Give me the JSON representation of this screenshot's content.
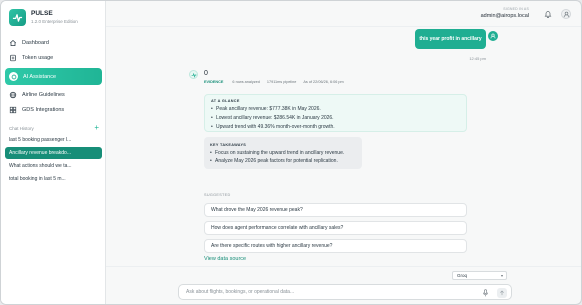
{
  "brand": {
    "name": "PULSE",
    "edition": "1.2.0 Enterprise Edition"
  },
  "nav": [
    {
      "label": "Dashboard",
      "icon": "home-icon"
    },
    {
      "label": "Token usage",
      "icon": "token-icon"
    },
    {
      "label": "AI Assistance",
      "icon": "assistant-icon",
      "active": true
    },
    {
      "label": "Airline Guidelines",
      "icon": "globe-icon"
    },
    {
      "label": "GDS Integrations",
      "icon": "grid-icon"
    }
  ],
  "history": {
    "label": "Chat History",
    "add_icon": "plus-icon",
    "items": [
      "last 5 booking passenger l...",
      "Ancillary revenue breakdo...",
      "What actions should we ta...",
      "total booking in last 5 m..."
    ],
    "active_index": 1
  },
  "topbar": {
    "signed_label": "SIGNED IN AS",
    "user": "admin@airops.local"
  },
  "chat": {
    "user_message": "this year profit in ancillary",
    "user_time": "12:45 pm",
    "bot_answer": "0",
    "meta": {
      "evidence": "EVIDENCE",
      "rows": "6 rows analyzed",
      "pipeline": "17911ms pipeline",
      "as_of": "As of 22/06/26, 6:06 pm"
    },
    "glance": {
      "title": "AT A GLANCE",
      "bullets": [
        "Peak ancillary revenue: $777.38K in May 2026.",
        "Lowest ancillary revenue: $286.54K in January 2026.",
        "Upward trend with 49.36% month-over-month growth."
      ]
    },
    "takeaways": {
      "title": "KEY TAKEAWAYS",
      "bullets": [
        "Focus on sustaining the upward trend in ancillary revenue.",
        "Analyze May 2026 peak factors for potential replication."
      ]
    },
    "suggested_label": "SUGGESTED",
    "suggestions": [
      "What drove the May 2026 revenue peak?",
      "How does agent performance correlate with ancillary sales?",
      "Are there specific routes with higher ancillary revenue?"
    ],
    "view_source": "View data source"
  },
  "composer": {
    "model": "Groq",
    "placeholder": "Ask about flights, bookings, or operational data..."
  },
  "colors": {
    "accent": "#1fae92",
    "accent_dark": "#178e78"
  }
}
